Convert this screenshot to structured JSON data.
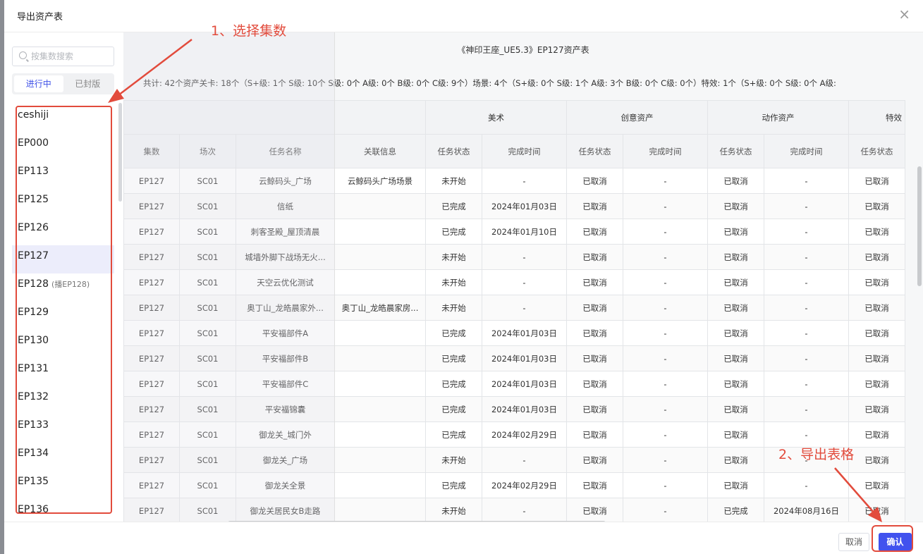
{
  "modal": {
    "title": "导出资产表",
    "close": "×"
  },
  "sidebar": {
    "search_placeholder": "按集数搜索",
    "tabs": [
      {
        "label": "进行中"
      },
      {
        "label": "已封版"
      }
    ],
    "episodes": [
      {
        "label": "ceshiji",
        "note": ""
      },
      {
        "label": "EP000",
        "note": ""
      },
      {
        "label": "EP113",
        "note": ""
      },
      {
        "label": "EP125",
        "note": ""
      },
      {
        "label": "EP126",
        "note": ""
      },
      {
        "label": "EP127",
        "note": ""
      },
      {
        "label": "EP128",
        "note": "(播EP128)"
      },
      {
        "label": "EP129",
        "note": ""
      },
      {
        "label": "EP130",
        "note": ""
      },
      {
        "label": "EP131",
        "note": ""
      },
      {
        "label": "EP132",
        "note": ""
      },
      {
        "label": "EP133",
        "note": ""
      },
      {
        "label": "EP134",
        "note": ""
      },
      {
        "label": "EP135",
        "note": ""
      },
      {
        "label": "EP136",
        "note": ""
      }
    ],
    "selected_episode": "EP127"
  },
  "main": {
    "doc_title": "《神印王座_UE5.3》EP127资产表",
    "summary": "共计:  42个资产关卡: 18个（S+级: 1个 S级: 10个 S级: 0个 A级: 0个 B级: 0个 C级: 9个）场景: 4个（S+级: 0个 S级: 1个 A级: 3个 B级: 0个 C级: 0个）特效: 1个（S+级: 0个 S级: 0个 A级:",
    "group_headers": [
      "",
      "美术",
      "创意资产",
      "动作资产",
      "特效"
    ],
    "headers": [
      "集数",
      "场次",
      "任务名称",
      "关联信息",
      "任务状态",
      "完成时间",
      "任务状态",
      "完成时间",
      "任务状态",
      "完成时间",
      "任务状态"
    ],
    "rows": [
      [
        "EP127",
        "SC01",
        "云鲸码头_广场",
        "云鲸码头广场场景",
        "未开始",
        "-",
        "已取消",
        "-",
        "已取消",
        "-",
        "已取消"
      ],
      [
        "EP127",
        "SC01",
        "信纸",
        "",
        "已完成",
        "2024年01月03日",
        "已取消",
        "-",
        "已取消",
        "-",
        "已取消"
      ],
      [
        "EP127",
        "SC01",
        "刺客圣殿_屋顶清晨",
        "",
        "已完成",
        "2024年01月10日",
        "已取消",
        "-",
        "已取消",
        "-",
        "已取消"
      ],
      [
        "EP127",
        "SC01",
        "城墙外脚下战场无火...",
        "",
        "未开始",
        "-",
        "已取消",
        "-",
        "已取消",
        "-",
        "已取消"
      ],
      [
        "EP127",
        "SC01",
        "天空云优化测试",
        "",
        "未开始",
        "-",
        "已取消",
        "-",
        "已取消",
        "-",
        "已取消"
      ],
      [
        "EP127",
        "SC01",
        "奥丁山_龙皓晨家外...",
        "奥丁山_龙皓晨家房...",
        "未开始",
        "-",
        "已取消",
        "-",
        "已取消",
        "-",
        "已取消"
      ],
      [
        "EP127",
        "SC01",
        "平安福部件A",
        "",
        "已完成",
        "2024年01月03日",
        "已取消",
        "-",
        "已取消",
        "-",
        "已取消"
      ],
      [
        "EP127",
        "SC01",
        "平安福部件B",
        "",
        "已完成",
        "2024年01月03日",
        "已取消",
        "-",
        "已取消",
        "-",
        "已取消"
      ],
      [
        "EP127",
        "SC01",
        "平安福部件C",
        "",
        "已完成",
        "2024年01月03日",
        "已取消",
        "-",
        "已取消",
        "-",
        "已取消"
      ],
      [
        "EP127",
        "SC01",
        "平安福锦囊",
        "",
        "已完成",
        "2024年01月03日",
        "已取消",
        "-",
        "已取消",
        "-",
        "已取消"
      ],
      [
        "EP127",
        "SC01",
        "御龙关_城门外",
        "",
        "已完成",
        "2024年02月29日",
        "已取消",
        "-",
        "已取消",
        "-",
        "已取消"
      ],
      [
        "EP127",
        "SC01",
        "御龙关_广场",
        "",
        "未开始",
        "-",
        "已取消",
        "-",
        "已取消",
        "-",
        "已取消"
      ],
      [
        "EP127",
        "SC01",
        "御龙关全景",
        "",
        "已完成",
        "2024年02月29日",
        "已取消",
        "-",
        "已取消",
        "-",
        "已取消"
      ],
      [
        "EP127",
        "SC01",
        "御龙关居民女B走路",
        "",
        "未开始",
        "-",
        "已取消",
        "-",
        "已完成",
        "2024年08月16日",
        "已取消"
      ]
    ]
  },
  "footer": {
    "cancel_label": "取消",
    "ok_label": "确认"
  },
  "annotations": {
    "step1": "1、选择集数",
    "step2": "2、导出表格",
    "color": "#e24b3c"
  }
}
